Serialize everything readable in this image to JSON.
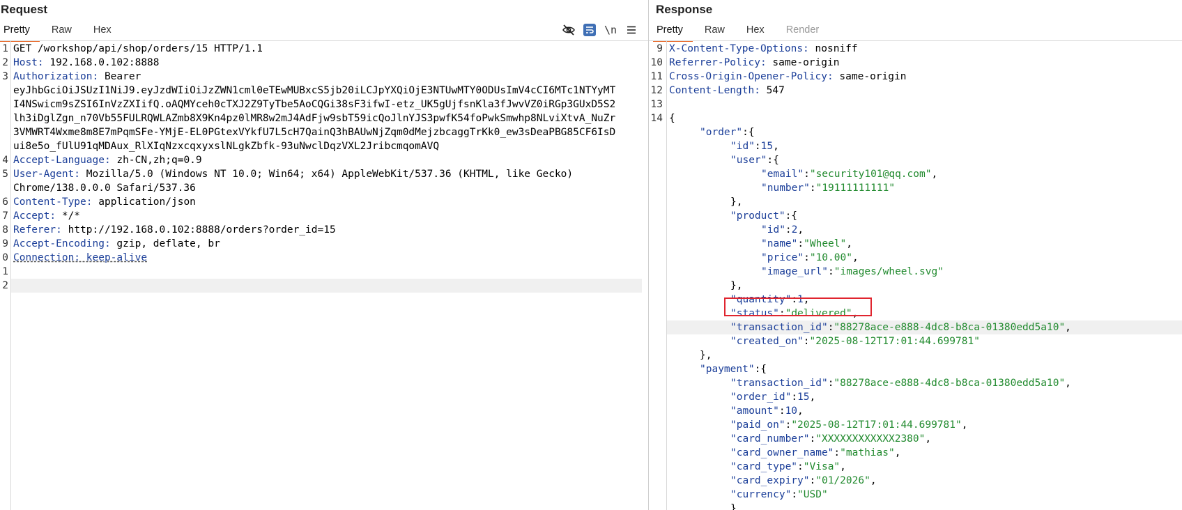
{
  "request": {
    "title": "Request",
    "tabs": [
      "Pretty",
      "Raw",
      "Hex"
    ],
    "toolbar_icons": [
      "eye-slash-icon",
      "wrap-lines-icon",
      "newline-icon",
      "menu-icon"
    ],
    "newline_label": "\\n",
    "line_numbers": [
      "1",
      "2",
      "3",
      "4",
      "5",
      "6",
      "7",
      "8",
      "9",
      "0",
      "1",
      "2"
    ],
    "request_line": "GET /workshop/api/shop/orders/15 HTTP/1.1",
    "host": {
      "key": "Host:",
      "value": " 192.168.0.102:8888"
    },
    "authorization": {
      "key": "Authorization:",
      "value": " Bearer",
      "token_lines": [
        "eyJhbGciOiJSUzI1NiJ9.eyJzdWIiOiJzZWN1cml0eTEwMUBxcS5jb20iLCJpYXQiOjE3NTUwMTY0ODUsImV4cCI6MTc1NTYyMT",
        "I4NSwicm9sZSI6InVzZXIifQ.oAQMYceh0cTXJ2Z9TyTbe5AoCQGi38sF3ifwI-etz_UK5gUjfsnKla3fJwvVZ0iRGp3GUxD5S2",
        "lh3iDglZgn_n70Vb55FULRQWLAZmb8X9Kn4pz0lMR8w2mJ4AdFjw9sbT59icQoJlnYJS3pwfK54foPwkSmwhp8NLviXtvA_NuZr",
        "3VMWRT4Wxme8m8E7mPqmSFe-YMjE-EL0PGtexVYkfU7L5cH7QainQ3hBAUwNjZqm0dMejzbcaggTrKk0_ew3sDeaPBG85CF6IsD",
        "ui8e5o_fUlU91qMDAux_RlXIqNzxcqxyxslNLgkZbfk-93uNwclDqzVXL2JribcmqomAVQ"
      ]
    },
    "accept_language": {
      "key": "Accept-Language:",
      "value": " zh-CN,zh;q=0.9"
    },
    "user_agent": {
      "key": "User-Agent:",
      "value": " Mozilla/5.0 (Windows NT 10.0; Win64; x64) AppleWebKit/537.36 (KHTML, like Gecko)",
      "cont": "Chrome/138.0.0.0 Safari/537.36"
    },
    "content_type": {
      "key": "Content-Type:",
      "value": " application/json"
    },
    "accept": {
      "key": "Accept:",
      "value": " */*"
    },
    "referer": {
      "key": "Referer:",
      "value": " http://192.168.0.102:8888/orders?order_id=15"
    },
    "accept_encoding": {
      "key": "Accept-Encoding:",
      "value": " gzip, deflate, br"
    },
    "connection": "Connection: keep-alive"
  },
  "response": {
    "title": "Response",
    "tabs": [
      "Pretty",
      "Raw",
      "Hex",
      "Render"
    ],
    "headers": [
      {
        "n": "9",
        "key": "X-Content-Type-Options:",
        "value": " nosniff"
      },
      {
        "n": "10",
        "key": "Referrer-Policy:",
        "value": " same-origin"
      },
      {
        "n": "11",
        "key": "Cross-Origin-Opener-Policy:",
        "value": " same-origin"
      },
      {
        "n": "12",
        "key": "Content-Length:",
        "value": " 547"
      }
    ],
    "blank_line_number": "13",
    "body_line_number": "14",
    "json": {
      "order": {
        "id": "15",
        "user": {
          "email": "security101@qq.com",
          "number": "19111111111"
        },
        "product": {
          "id": "2",
          "name": "Wheel",
          "price": "10.00",
          "image_url": "images/wheel.svg"
        },
        "quantity": "1",
        "status": "delivered",
        "transaction_id": "88278ace-e888-4dc8-b8ca-01380edd5a10",
        "created_on": "2025-08-12T17:01:44.699781"
      },
      "payment": {
        "transaction_id": "88278ace-e888-4dc8-b8ca-01380edd5a10",
        "order_id": "15",
        "amount": "10",
        "paid_on": "2025-08-12T17:01:44.699781",
        "card_number": "XXXXXXXXXXXX2380",
        "card_owner_name": "mathias",
        "card_type": "Visa",
        "card_expiry": "01/2026",
        "currency": "USD"
      }
    }
  },
  "colors": {
    "accent_tab": "#e8692a",
    "highlight_box": "#e0252f",
    "header_key": "#1c3f99",
    "json_string": "#218a2e"
  }
}
